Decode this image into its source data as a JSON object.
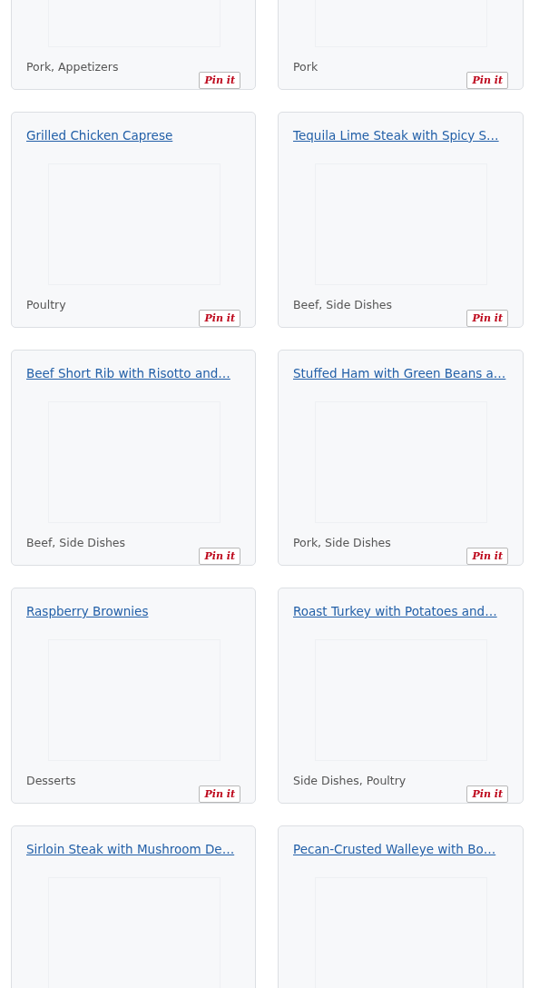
{
  "recipes": [
    {
      "tags": "Pork, Appetizers",
      "pin_label": "Pin it"
    },
    {
      "tags": "Pork",
      "pin_label": "Pin it"
    },
    {
      "title": "Grilled Chicken Caprese",
      "tags": "Poultry",
      "pin_label": "Pin it"
    },
    {
      "title": "Tequila Lime Steak with Spicy S…",
      "tags": "Beef, Side Dishes",
      "pin_label": "Pin it"
    },
    {
      "title": "Beef Short Rib with Risotto and…",
      "tags": "Beef, Side Dishes",
      "pin_label": "Pin it"
    },
    {
      "title": "Stuffed Ham with Green Beans a…",
      "tags": "Pork, Side Dishes",
      "pin_label": "Pin it"
    },
    {
      "title": "Raspberry Brownies",
      "tags": "Desserts",
      "pin_label": "Pin it"
    },
    {
      "title": "Roast Turkey with Potatoes and…",
      "tags": "Side Dishes, Poultry",
      "pin_label": "Pin it"
    },
    {
      "title": "Sirloin Steak with Mushroom De…"
    },
    {
      "title": "Pecan-Crusted Walleye with Bo…"
    }
  ]
}
